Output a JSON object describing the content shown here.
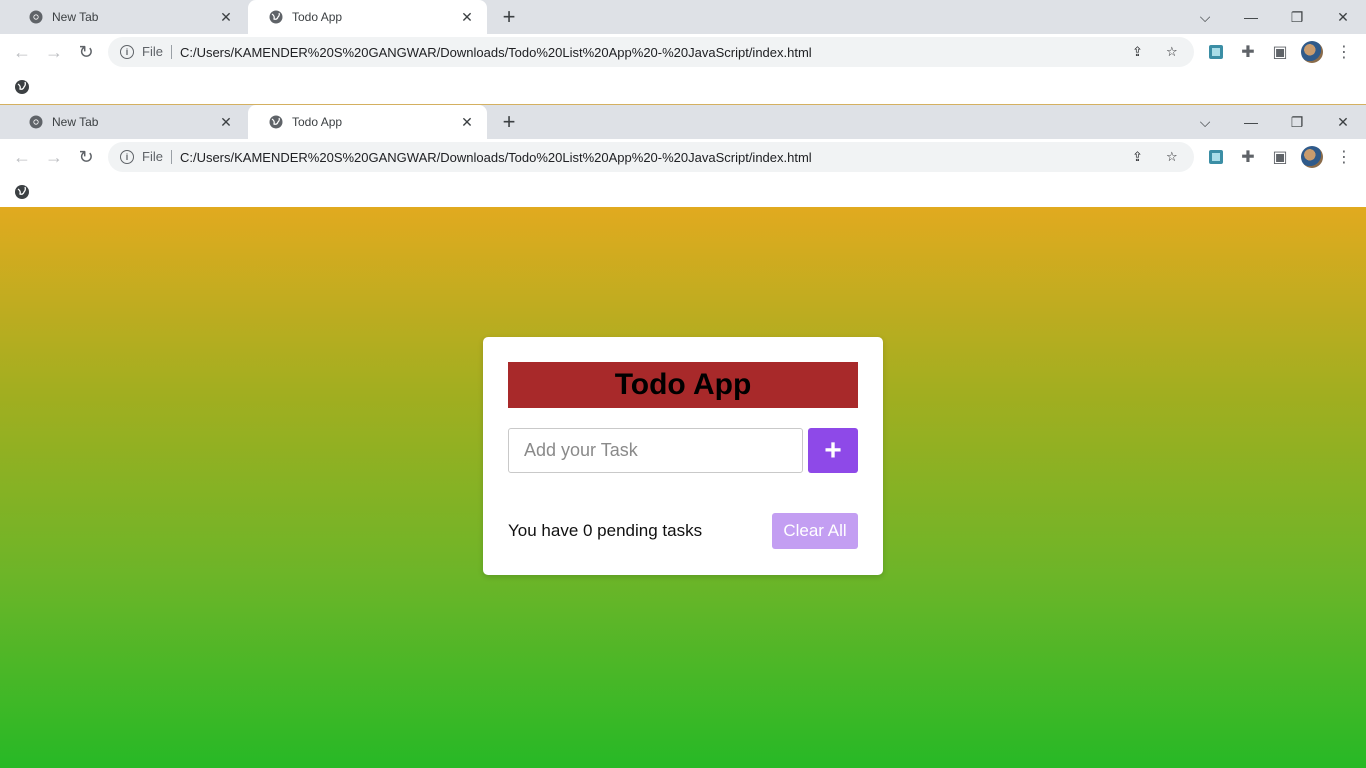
{
  "browser": {
    "tabs": [
      {
        "title": "New Tab",
        "icon": "chrome-icon"
      },
      {
        "title": "Todo App",
        "icon": "globe-icon"
      }
    ],
    "address": {
      "scheme_label": "File",
      "url": "C:/Users/KAMENDER%20S%20GANGWAR/Downloads/Todo%20List%20App%20-%20JavaScript/index.html"
    }
  },
  "app": {
    "title": "Todo App",
    "input_placeholder": "Add your Task",
    "input_value": "",
    "add_label": "+",
    "pending_text": "You have 0 pending tasks",
    "pending_count": 0,
    "clear_label": "Clear All"
  },
  "colors": {
    "heading_bg": "#a8292a",
    "add_button": "#8e49e8",
    "clear_button": "#c39ef2",
    "gradient_top": "#e1aa1f",
    "gradient_bottom": "#27b926"
  }
}
